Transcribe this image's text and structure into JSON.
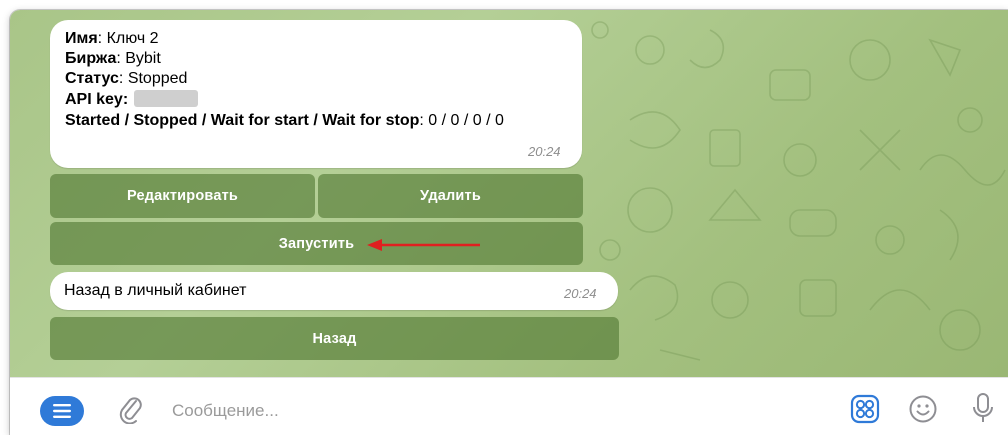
{
  "message": {
    "name_label": "Имя",
    "name_value": ": Ключ 2",
    "exchange_label": "Биржа",
    "exchange_value": ": Bybit",
    "status_label": "Статус",
    "status_value": ": Stopped",
    "apikey_label": "API key:",
    "stats_label": "Started / Stopped / Wait for start / Wait for stop",
    "stats_value": ": 0 / 0 / 0 / 0",
    "time": "20:24"
  },
  "keyboard1": {
    "edit": "Редактировать",
    "delete": "Удалить",
    "start": "Запустить"
  },
  "message2": {
    "text": "Назад в личный кабинет",
    "time": "20:24"
  },
  "keyboard2": {
    "back": "Назад"
  },
  "composer": {
    "placeholder": "Сообщение..."
  },
  "icons": {
    "menu": "menu-icon",
    "attach": "paperclip-icon",
    "stickers": "sticker-grid-icon",
    "emoji": "emoji-icon",
    "mic": "microphone-icon"
  },
  "colors": {
    "accent": "#2f7ad8",
    "arrow": "#e02020"
  }
}
